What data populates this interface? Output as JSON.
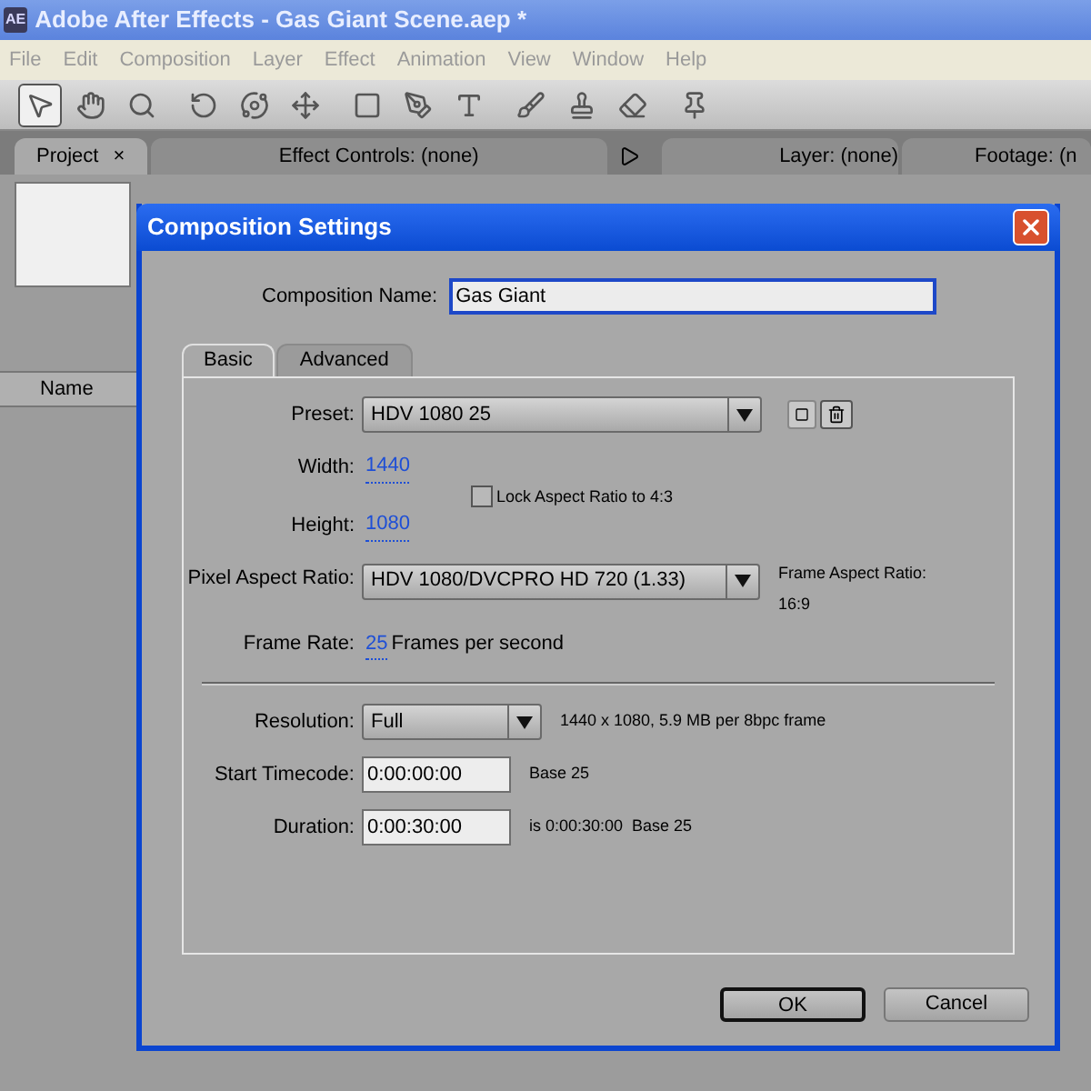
{
  "window": {
    "title": "Adobe After Effects - Gas Giant Scene.aep *",
    "app_badge": "AE"
  },
  "menu": [
    "File",
    "Edit",
    "Composition",
    "Layer",
    "Effect",
    "Animation",
    "View",
    "Window",
    "Help"
  ],
  "toolbar": {
    "tools": [
      {
        "selected": true
      },
      {
        "selected": false
      },
      {
        "selected": false
      },
      {
        "selected": false
      },
      {
        "selected": false
      },
      {
        "selected": false
      },
      {
        "selected": false
      },
      {
        "selected": false
      },
      {
        "selected": false
      },
      {
        "selected": false
      },
      {
        "selected": false
      },
      {
        "selected": false
      },
      {
        "selected": false
      }
    ]
  },
  "left_tabs": [
    {
      "label": "Project",
      "selected": true,
      "close": "×"
    },
    {
      "label": "Effect Controls: (none)",
      "selected": false
    }
  ],
  "right_tabs": [
    {
      "label": "Layer: (none)",
      "selected": false
    },
    {
      "label": "Footage: (n",
      "selected": false
    }
  ],
  "project_panel": {
    "column": "Name"
  },
  "dialog": {
    "title": "Composition Settings",
    "name_label": "Composition Name:",
    "name_value": "Gas Giant",
    "tabs": [
      {
        "label": "Basic",
        "selected": true
      },
      {
        "label": "Advanced",
        "selected": false
      }
    ],
    "preset": {
      "label": "Preset:",
      "value": "HDV 1080 25"
    },
    "width": {
      "label": "Width:",
      "value": "1440"
    },
    "height": {
      "label": "Height:",
      "value": "1080"
    },
    "lock": {
      "label": "Lock Aspect Ratio to 4:3",
      "checked": false
    },
    "pixel_aspect": {
      "label": "Pixel Aspect Ratio:",
      "value": "HDV 1080/DVCPRO HD 720 (1.33)",
      "frame_aspect_label": "Frame Aspect Ratio:",
      "frame_aspect_value": "16:9"
    },
    "frame_rate": {
      "label": "Frame Rate:",
      "value": "25",
      "unit": "Frames per second"
    },
    "resolution": {
      "label": "Resolution:",
      "value": "Full",
      "info": "1440 x 1080, 5.9 MB per 8bpc frame"
    },
    "start_timecode": {
      "label": "Start Timecode:",
      "value": "0:00:00:00",
      "info": "Base 25"
    },
    "duration": {
      "label": "Duration:",
      "value": "0:00:30:00",
      "info": "is 0:00:30:00  Base 25"
    },
    "buttons": [
      {
        "label": "OK",
        "default": true
      },
      {
        "label": "Cancel",
        "default": false
      }
    ]
  }
}
